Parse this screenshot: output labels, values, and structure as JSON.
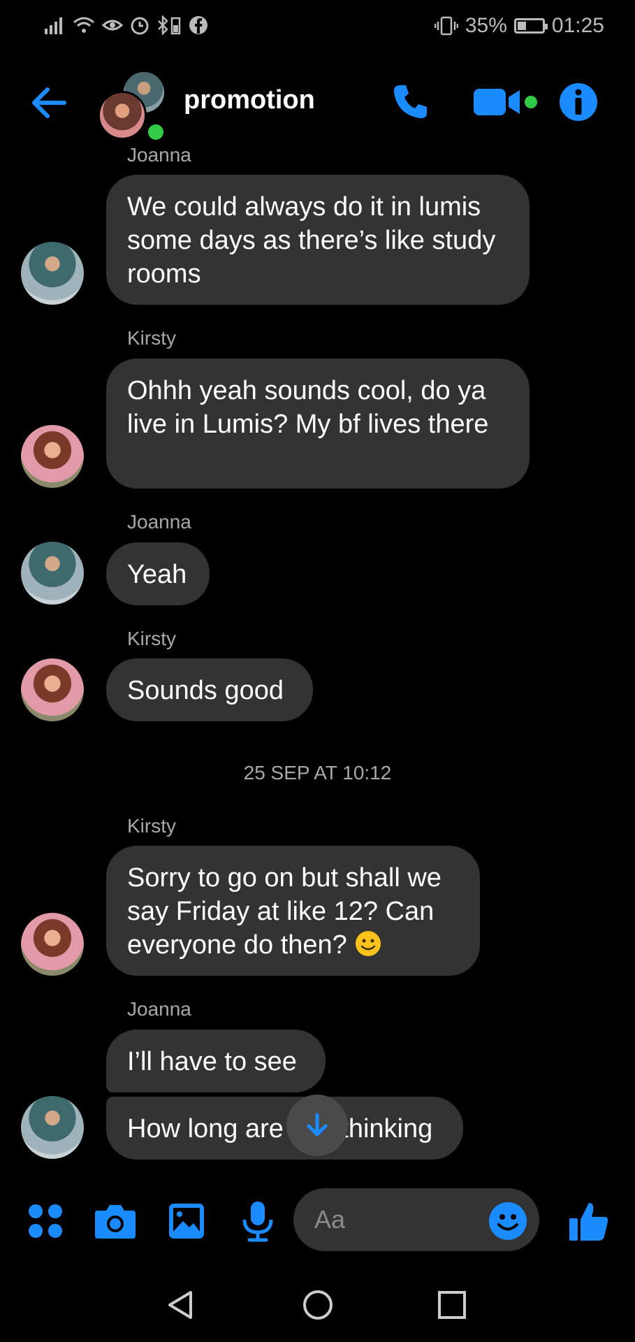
{
  "status_bar": {
    "battery_text": "35%",
    "battery_level": 0.35,
    "time": "01:25"
  },
  "header": {
    "title": "promotion",
    "online": true
  },
  "messages": [
    {
      "sender": "Joanna",
      "text": "We could always do it in lumis some days as there’s like study rooms"
    },
    {
      "sender": "Kirsty",
      "text": "Ohhh yeah sounds cool, do ya live in Lumis? My bf lives there"
    },
    {
      "sender": "Joanna",
      "text": "Yeah"
    },
    {
      "sender": "Kirsty",
      "text": "Sounds good"
    },
    {
      "sender": "Kirsty",
      "text": "Sorry to go on but shall we say Friday at like 12? Can everyone do then?"
    },
    {
      "sender": "Joanna",
      "text": "I’ll have to see"
    },
    {
      "sender": "",
      "text": "How long are you thinking"
    }
  ],
  "timestamp": "25 SEP AT 10:12",
  "composer": {
    "placeholder": "Aa"
  },
  "colors": {
    "accent": "#1a8cff",
    "bubble": "#333333",
    "online": "#31cc46"
  },
  "icons": [
    "back-arrow-icon",
    "phone-icon",
    "video-camera-icon",
    "info-icon",
    "apps-grid-icon",
    "camera-icon",
    "gallery-icon",
    "microphone-icon",
    "emoji-icon",
    "thumbs-up-icon",
    "scroll-down-icon"
  ]
}
